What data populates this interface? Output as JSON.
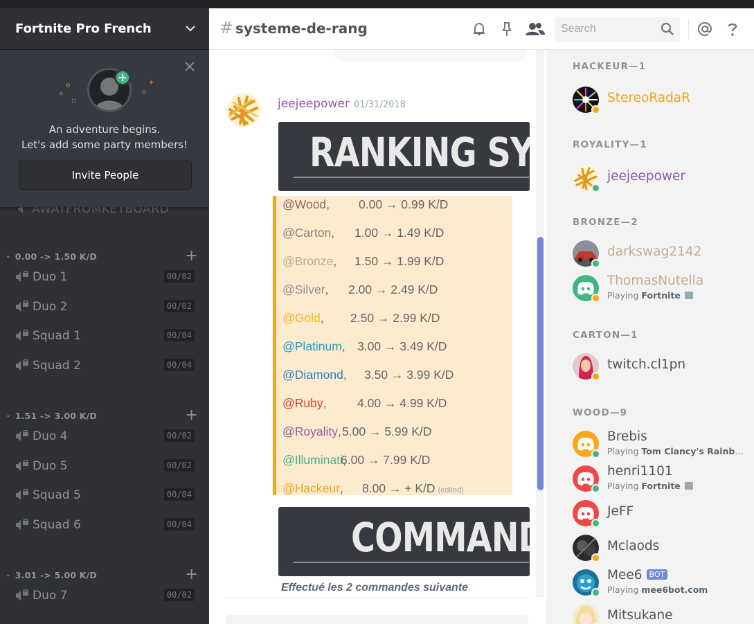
{
  "server": {
    "name": "Fortnite Pro French"
  },
  "invite": {
    "line1": "An adventure begins.",
    "line2": "Let's add some party members!",
    "button": "Invite People"
  },
  "afk_channel": "AWAYFROMKEYBOARD",
  "categories": [
    {
      "name": "0.00 -> 1.50 K/D",
      "channels": [
        {
          "name": "Duo 1",
          "limit": "00/02"
        },
        {
          "name": "Duo 2",
          "limit": "00/02"
        },
        {
          "name": "Squad 1",
          "limit": "00/04"
        },
        {
          "name": "Squad 2",
          "limit": "00/04"
        }
      ]
    },
    {
      "name": "1.51 -> 3.00 K/D",
      "channels": [
        {
          "name": "Duo 4",
          "limit": "00/02"
        },
        {
          "name": "Duo 5",
          "limit": "00/02"
        },
        {
          "name": "Squad 5",
          "limit": "00/04"
        },
        {
          "name": "Squad 6",
          "limit": "00/04"
        }
      ]
    },
    {
      "name": "3.01 -> 5.00 K/D",
      "channels": [
        {
          "name": "Duo 7",
          "limit": "00/02"
        }
      ]
    }
  ],
  "channel": {
    "hash": "#",
    "name": "systeme-de-rang"
  },
  "search": {
    "placeholder": "Search"
  },
  "message": {
    "author": "jeejeepower",
    "timestamp": "01/31/2018",
    "banner1": "RANKING SYSTEM",
    "banner2": "COMMANDS",
    "footer": "Effectué les 2 commandes suivante",
    "edited": "(edited)",
    "ranks": [
      {
        "name": "@Wood",
        "sep": ",",
        "range": "0.00 → 0.99  K/D",
        "color": "#8a6d5a"
      },
      {
        "name": "@Carton",
        "sep": ",",
        "range": "1.00 → 1.49  K/D",
        "color": "#8a7f72"
      },
      {
        "name": "@Bronze",
        "sep": ",",
        "range": "1.50 → 1.99  K/D",
        "color": "#c2a98a"
      },
      {
        "name": "@Silver",
        "sep": ",",
        "range": "2.00 → 2.49  K/D",
        "color": "#8f8f8f"
      },
      {
        "name": "@Gold",
        "sep": ",",
        "range": "2.50 → 2.99  K/D",
        "color": "#f1b71a"
      },
      {
        "name": "@Platinum",
        "sep": ",",
        "range": "3.00 → 3.49  K/D",
        "color": "#1ba1c8"
      },
      {
        "name": "@Diamond",
        "sep": ",",
        "range": "3.50 → 3.99  K/D",
        "color": "#2f7fc9"
      },
      {
        "name": "@Ruby",
        "sep": ",",
        "range": "4.00 → 4.99  K/D",
        "color": "#d2442f"
      },
      {
        "name": "@Royality",
        "sep": ",",
        "range": "5.00 → 5.99  K/D",
        "color": "#8e5ba8"
      },
      {
        "name": "@Illuminati",
        "sep": ",",
        "range": "6.00 → 7.99  K/D",
        "color": "#43b581"
      },
      {
        "name": "@Hackeur",
        "sep": ",",
        "range": "8.00 → +  K/D",
        "color": "#f0a51e"
      }
    ]
  },
  "roles": [
    {
      "label": "HACKEUR—1",
      "members": [
        {
          "name": "StereoRadaR",
          "color": "#f0a51e",
          "status": "idle",
          "avatar": "burst"
        }
      ]
    },
    {
      "label": "ROYALITY—1",
      "members": [
        {
          "name": "jeejeepower",
          "color": "#8e5ba8",
          "status": "online",
          "avatar": "fries"
        }
      ]
    },
    {
      "label": "BRONZE—2",
      "members": [
        {
          "name": "darkswag2142",
          "color": "#c2ad8a",
          "status": "online",
          "avatar": "car"
        },
        {
          "name": "ThomasNutella",
          "color": "#c2ad8a",
          "status": "idle",
          "avatar": "discord-green",
          "activity_prefix": "Playing ",
          "activity": "Fortnite",
          "rich_presence": true
        }
      ]
    },
    {
      "label": "CARTON—1",
      "members": [
        {
          "name": "twitch.cl1pn",
          "color": "#4f545c",
          "status": "idle",
          "avatar": "person-red"
        }
      ]
    },
    {
      "label": "WOOD—9",
      "members": [
        {
          "name": "Brebis",
          "color": "#4f545c",
          "status": "online",
          "avatar": "discord-orange",
          "activity_prefix": "Playing ",
          "activity": "Tom Clancy's Rainbow Six Siege"
        },
        {
          "name": "henri1101",
          "color": "#4f545c",
          "status": "online",
          "avatar": "discord-red",
          "activity_prefix": "Playing ",
          "activity": "Fortnite",
          "rich_presence": true
        },
        {
          "name": "JeFF",
          "color": "#4f545c",
          "status": "online",
          "avatar": "discord-red"
        },
        {
          "name": "Mclaods",
          "color": "#4f545c",
          "status": "idle",
          "avatar": "dark-art"
        },
        {
          "name": "Mee6",
          "color": "#4f545c",
          "status": "online",
          "avatar": "mee6",
          "bot": "BOT",
          "activity_prefix": "Playing ",
          "activity": "mee6bot.com"
        },
        {
          "name": "Mitsukane",
          "color": "#4f545c",
          "status": "online",
          "avatar": "anime"
        }
      ]
    }
  ]
}
